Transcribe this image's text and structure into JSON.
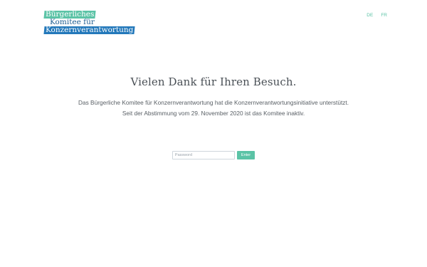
{
  "logo": {
    "line1": "Bürgerliches",
    "line2": "Komitee für",
    "line3": "Konzernverantwortung"
  },
  "language_switch": [
    {
      "label": "DE"
    },
    {
      "label": "FR"
    }
  ],
  "main": {
    "headline": "Vielen Dank für Ihren Besuch.",
    "intro": "Das Bürgerliche Komitee für Konzernverantwortung hat die Konzernverantwortungsinitiative unterstützt. Seit der Abstimmung vom 29. November 2020 ist das Komitee inaktiv."
  },
  "login_form": {
    "password_placeholder": "Password",
    "password_value": "",
    "submit_label": "Enter"
  },
  "colors": {
    "accent": "#5bc3a6",
    "brand_blue": "#2378ba",
    "text": "#555a5f"
  }
}
